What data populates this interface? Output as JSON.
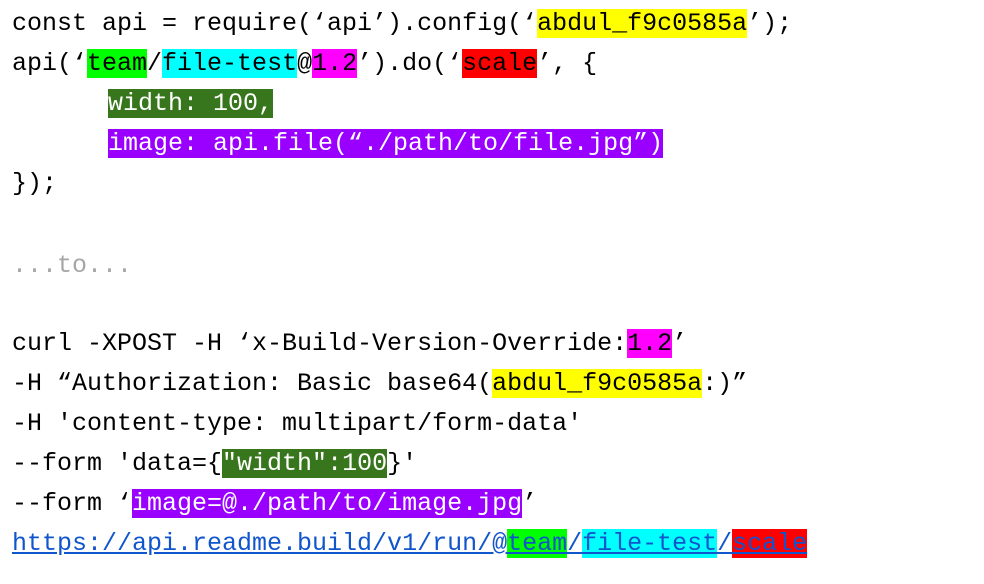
{
  "js_snippet": {
    "l1_a": "const api = require(‘api’).config(‘",
    "l1_key": "abdul_f9c0585a",
    "l1_b": "’);",
    "l2_a": "api(‘",
    "l2_team": "team",
    "l2_slash": "/",
    "l2_project": "file-test",
    "l2_at": "@",
    "l2_version": "1.2",
    "l2_b": "’).do(‘",
    "l2_action": "scale",
    "l2_c": "’, {",
    "l3_width": "width: 100,",
    "l4_image": "image: api.file(“./path/to/file.jpg”)",
    "l5_close": "});"
  },
  "separator": "...to...",
  "curl_snippet": {
    "c1_a": "curl -XPOST -H ‘x-Build-Version-Override:",
    "c1_version": "1.2",
    "c1_b": "’",
    "c2_a": "-H “Authorization: Basic base64(",
    "c2_key": "abdul_f9c0585a",
    "c2_b": ":)”",
    "c3": "-H 'content-type: multipart/form-data'",
    "c4_a": "--form 'data={",
    "c4_width": "\"width\":100",
    "c4_b": "}'",
    "c5_a": "--form ‘",
    "c5_image": "image=@./path/to/image.jpg",
    "c5_b": "’"
  },
  "url": {
    "base": "https://api.readme.build/v1/run/@",
    "team": "team",
    "slash1": "/",
    "project": "file-test",
    "slash2": "/",
    "action": "scale"
  },
  "colors": {
    "api_key": "#ffff00",
    "team": "#00ff00",
    "project": "#00ffff",
    "version": "#ff00ff",
    "action": "#ff0000",
    "width": "#38761d",
    "image": "#9900ff"
  }
}
